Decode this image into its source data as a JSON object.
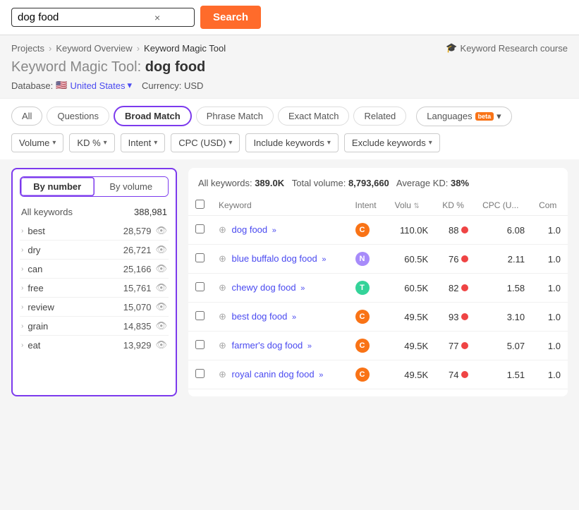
{
  "topBar": {
    "searchValue": "dog food",
    "searchPlaceholder": "dog food",
    "searchButtonLabel": "Search",
    "clearLabel": "×"
  },
  "breadcrumb": {
    "items": [
      "Projects",
      "Keyword Overview",
      "Keyword Magic Tool"
    ],
    "courseLink": "Keyword Research course"
  },
  "pageTitle": {
    "label": "Keyword Magic Tool:",
    "query": "dog food"
  },
  "dbRow": {
    "prefix": "Database:",
    "country": "United States",
    "currencyLabel": "Currency: USD"
  },
  "matchTabs": {
    "tabs": [
      "All",
      "Questions",
      "Broad Match",
      "Phrase Match",
      "Exact Match",
      "Related"
    ],
    "active": "Broad Match",
    "languagesLabel": "Languages",
    "betaLabel": "beta"
  },
  "filterRow": {
    "filters": [
      "Volume",
      "KD %",
      "Intent",
      "CPC (USD)",
      "Include keywords",
      "Exclude keywords"
    ]
  },
  "sidebar": {
    "tabs": [
      "By number",
      "By volume"
    ],
    "activeTab": "By number",
    "allKeywords": {
      "label": "All keywords",
      "count": "388,981"
    },
    "items": [
      {
        "keyword": "best",
        "count": "28,579"
      },
      {
        "keyword": "dry",
        "count": "26,721"
      },
      {
        "keyword": "can",
        "count": "25,166"
      },
      {
        "keyword": "free",
        "count": "15,761"
      },
      {
        "keyword": "review",
        "count": "15,070"
      },
      {
        "keyword": "grain",
        "count": "14,835"
      },
      {
        "keyword": "eat",
        "count": "13,929"
      }
    ]
  },
  "tableSection": {
    "summary": {
      "allKeywordsLabel": "All keywords:",
      "allKeywordsValue": "389.0K",
      "totalVolumeLabel": "Total volume:",
      "totalVolumeValue": "8,793,660",
      "avgKdLabel": "Average KD:",
      "avgKdValue": "38%"
    },
    "columns": [
      "Keyword",
      "Intent",
      "Volu",
      "KD %",
      "CPC (U...",
      "Com"
    ],
    "rows": [
      {
        "keyword": "dog food",
        "intent": "C",
        "volume": "110.0K",
        "kd": "88",
        "cpc": "6.08",
        "com": "1.0"
      },
      {
        "keyword": "blue buffalo dog food",
        "intent": "N",
        "volume": "60.5K",
        "kd": "76",
        "cpc": "2.11",
        "com": "1.0"
      },
      {
        "keyword": "chewy dog food",
        "intent": "T",
        "volume": "60.5K",
        "kd": "82",
        "cpc": "1.58",
        "com": "1.0"
      },
      {
        "keyword": "best dog food",
        "intent": "C",
        "volume": "49.5K",
        "kd": "93",
        "cpc": "3.10",
        "com": "1.0"
      },
      {
        "keyword": "farmer's dog food",
        "intent": "C",
        "volume": "49.5K",
        "kd": "77",
        "cpc": "5.07",
        "com": "1.0"
      },
      {
        "keyword": "royal canin dog food",
        "intent": "C",
        "volume": "49.5K",
        "kd": "74",
        "cpc": "1.51",
        "com": "1.0"
      }
    ]
  },
  "icons": {
    "chevronDown": "▾",
    "chevronRight": "›",
    "eye": "👁",
    "arrows": "»",
    "plus": "⊕",
    "flag": "🇺🇸",
    "course": "🎓",
    "sort": "⇅"
  }
}
